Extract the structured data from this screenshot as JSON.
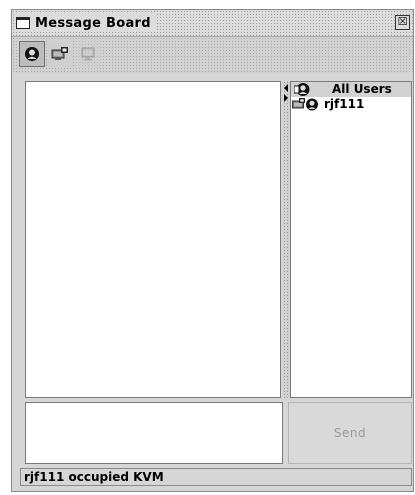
{
  "window": {
    "title": "Message Board",
    "close_glyph": "☒"
  },
  "toolbar": {
    "buttons": [
      {
        "icon": "user-icon",
        "state": "pressed"
      },
      {
        "icon": "kvm-occupy-icon",
        "state": "normal"
      },
      {
        "icon": "kvm-release-icon",
        "state": "disabled"
      }
    ]
  },
  "user_list": {
    "items": [
      {
        "label": "All Users",
        "icon": "all-users-icon",
        "selected": true
      },
      {
        "label": "rjf111",
        "icon": "kvm-user-icon",
        "selected": false
      }
    ]
  },
  "composer": {
    "send_label": "Send"
  },
  "status": {
    "text": "rjf111 occupied KVM"
  }
}
